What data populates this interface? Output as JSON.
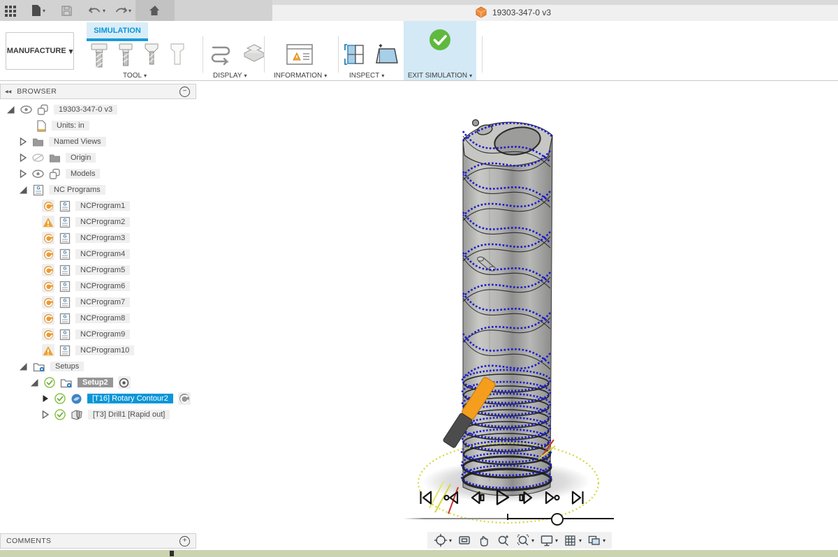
{
  "app": {
    "title": "19303-347-0 v3"
  },
  "ribbon": {
    "workspace_label": "MANUFACTURE",
    "tab_simulation": "SIMULATION",
    "groups": {
      "tool": "TOOL",
      "display": "DISPLAY",
      "information": "INFORMATION",
      "inspect": "INSPECT",
      "exit_simulation": "EXIT SIMULATION"
    }
  },
  "browser": {
    "header": "BROWSER",
    "root": "19303-347-0 v3",
    "units": "Units: in",
    "named_views": "Named Views",
    "origin": "Origin",
    "models": "Models",
    "nc_programs": "NC Programs",
    "programs": [
      {
        "label": "NCProgram1",
        "status": "regenerate"
      },
      {
        "label": "NCProgram2",
        "status": "warning"
      },
      {
        "label": "NCProgram3",
        "status": "regenerate"
      },
      {
        "label": "NCProgram4",
        "status": "regenerate"
      },
      {
        "label": "NCProgram5",
        "status": "regenerate"
      },
      {
        "label": "NCProgram6",
        "status": "regenerate"
      },
      {
        "label": "NCProgram7",
        "status": "regenerate"
      },
      {
        "label": "NCProgram8",
        "status": "regenerate"
      },
      {
        "label": "NCProgram9",
        "status": "regenerate"
      },
      {
        "label": "NCProgram10",
        "status": "warning"
      }
    ],
    "setups": "Setups",
    "setup2": "Setup2",
    "operations": [
      {
        "label": "[T16] Rotary Contour2",
        "status": "ok",
        "selected": true,
        "generating": true
      },
      {
        "label": "[T3] Drill1 [Rapid out]",
        "status": "ok",
        "selected": false
      }
    ]
  },
  "comments": {
    "header": "COMMENTS"
  },
  "simulation": {
    "timeline_position_percent": 72,
    "playback_buttons": [
      "go-to-start",
      "play-reverse",
      "step-back",
      "play",
      "step-forward",
      "play-to-end",
      "go-to-end"
    ]
  },
  "nav_buttons": [
    "orbit",
    "look-at",
    "pan",
    "zoom",
    "fit",
    "display-settings",
    "grid",
    "viewports"
  ],
  "icons": {
    "caret": "▾",
    "double_left": "◀◀",
    "minus": "−",
    "plus": "+"
  },
  "colors": {
    "accent_blue": "#0a96d7",
    "success_green": "#5fb93f",
    "warning_orange": "#f0a22e",
    "regenerate_orange": "#e89c35",
    "toolpath_blue": "#1a1ace",
    "tool_orange": "#f59e1e",
    "rotary_axis_yellow": "#d6d63a"
  }
}
